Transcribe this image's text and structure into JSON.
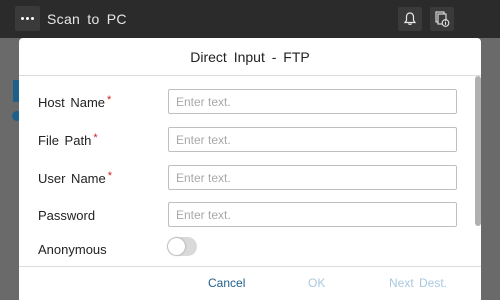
{
  "topbar": {
    "title": "Scan to PC"
  },
  "dialog": {
    "title": "Direct Input - FTP",
    "fields": [
      {
        "label": "Host Name",
        "required": true,
        "placeholder": "Enter text."
      },
      {
        "label": "File Path",
        "required": true,
        "placeholder": "Enter text."
      },
      {
        "label": "User Name",
        "required": true,
        "placeholder": "Enter text."
      },
      {
        "label": "Password",
        "required": false,
        "placeholder": "Enter text."
      }
    ],
    "anonymous_label": "Anonymous",
    "anonymous_on": false,
    "required_mark": "*",
    "buttons": {
      "cancel": "Cancel",
      "ok": "OK",
      "next": "Next Dest."
    }
  },
  "colors": {
    "accent": "#1f5f8c",
    "disabled_button": "#a9c8df",
    "required": "#d31a1a"
  },
  "icons": {
    "menu": "ellipsis-icon",
    "notifications": "bell-icon",
    "job_status": "job-status-icon"
  }
}
